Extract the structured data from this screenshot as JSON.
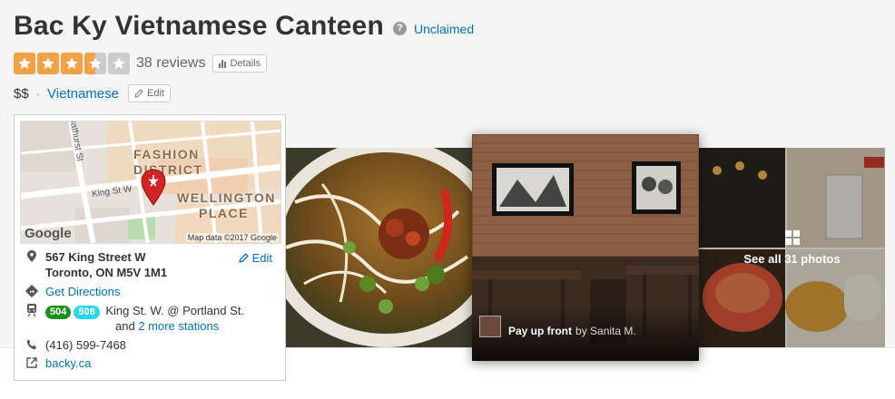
{
  "header": {
    "title": "Bac Ky Vietnamese Canteen",
    "claim_status": "Unclaimed",
    "rating_stars": 3.5,
    "review_count": "38 reviews",
    "details_label": "Details",
    "price": "$$",
    "category": "Vietnamese",
    "edit_label": "Edit"
  },
  "map": {
    "labels": {
      "district_line1": "FASHION",
      "district_line2": "DISTRICT",
      "place_line1": "WELLINGTON",
      "place_line2": "PLACE",
      "street_1": "Bathurst St",
      "street_2": "King St W"
    },
    "logo": "Google",
    "credit": "Map data ©2017 Google"
  },
  "info": {
    "address_line1": "567 King Street W",
    "address_line2": "Toronto, ON M5V 1M1",
    "edit_label": "Edit",
    "directions": "Get Directions",
    "transit_badges": [
      {
        "label": "504",
        "color": "#1d8f1d"
      },
      {
        "label": "508",
        "color": "#2ad6e8"
      }
    ],
    "transit_stop": "King St. W. @ Portland St.",
    "transit_more_prefix": "and",
    "transit_more_link": "2 more stations",
    "phone": "(416) 599-7468",
    "website": "backy.ca"
  },
  "photos": {
    "caption_title": "Pay up front",
    "caption_by": "by Sanita M.",
    "see_all": "See all 31 photos"
  },
  "colors": {
    "link": "#0073bb",
    "star_on": "#f3a145",
    "star_off": "#cccccc",
    "map_pin": "#d32323"
  }
}
